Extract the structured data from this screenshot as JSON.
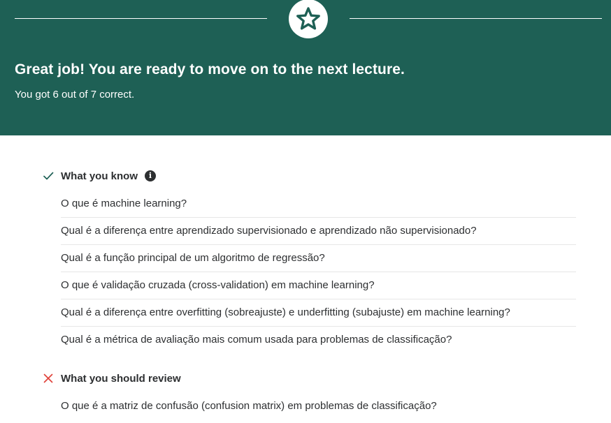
{
  "banner": {
    "headline": "Great job! You are ready to move on to the next lecture.",
    "score_text": "You got 6 out of 7 correct.",
    "background_color": "#1e6055",
    "badge_icon": "star-icon"
  },
  "know_section": {
    "title": "What you know",
    "status_icon": "check-icon",
    "info_icon": "info-icon",
    "info_glyph": "i",
    "status_color": "#1e6055",
    "items": [
      "O que é machine learning?",
      "Qual é a diferença entre aprendizado supervisionado e aprendizado não supervisionado?",
      "Qual é a função principal de um algoritmo de regressão?",
      "O que é validação cruzada (cross-validation) em machine learning?",
      "Qual é a diferença entre overfitting (sobreajuste) e underfitting (subajuste) em machine learning?",
      "Qual é a métrica de avaliação mais comum usada para problemas de classificação?"
    ]
  },
  "review_section": {
    "title": "What you should review",
    "status_icon": "x-icon",
    "status_color": "#e0433b",
    "items": [
      "O que é a matriz de confusão (confusion matrix) em problemas de classificação?"
    ]
  }
}
